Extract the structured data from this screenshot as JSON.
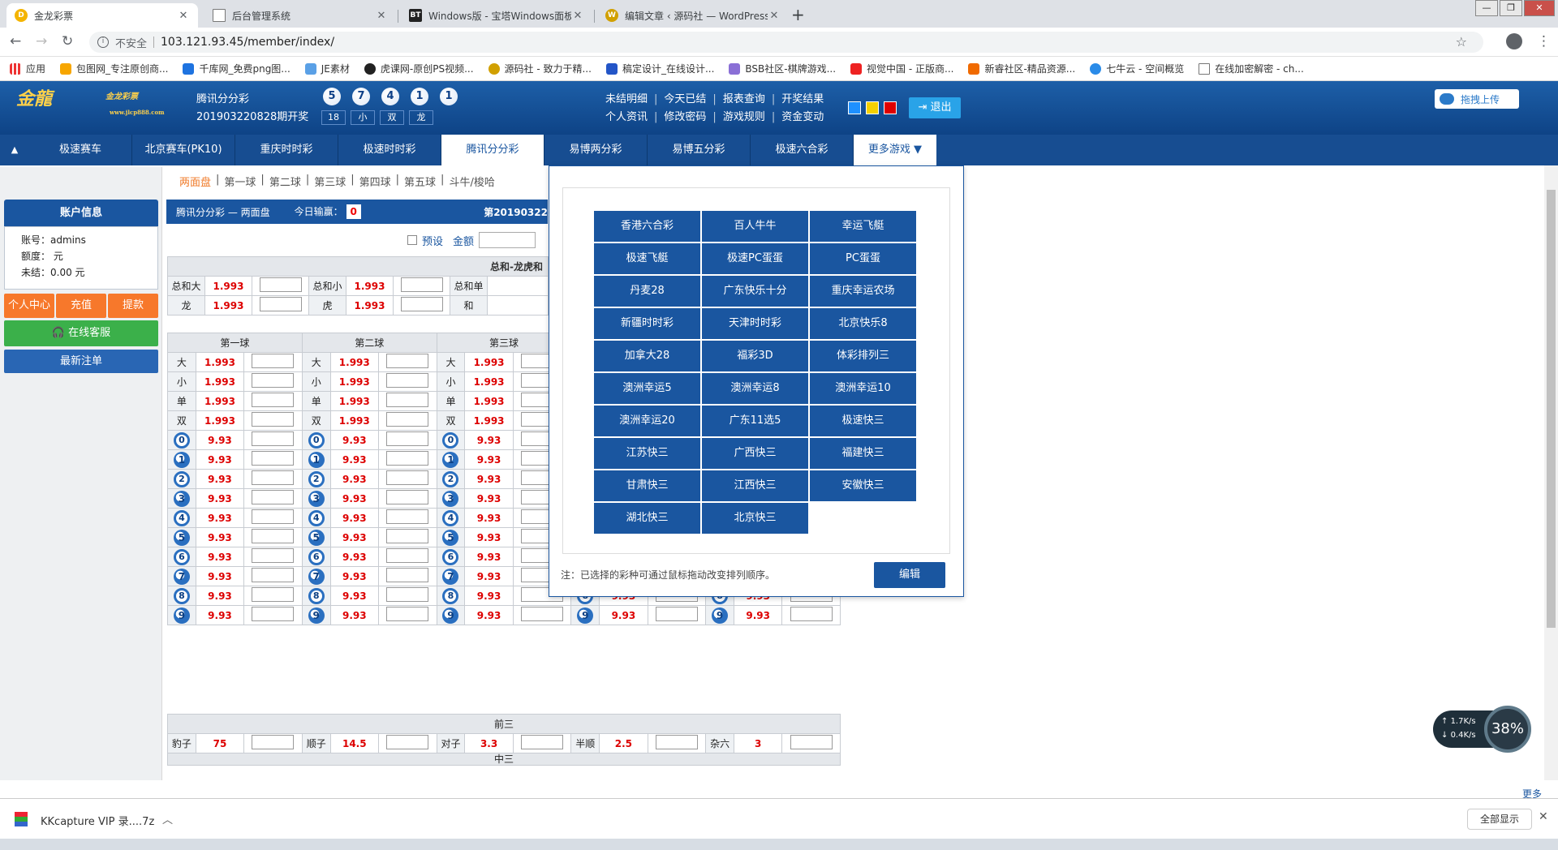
{
  "browser": {
    "tabs": [
      {
        "title": "金龙彩票",
        "color": "#f4b400",
        "glyph": "D"
      },
      {
        "title": "后台管理系统",
        "color": "#9aa0a6",
        "glyph": ""
      },
      {
        "title": "Windows版 - 宝塔Windows面板",
        "color": "#222222",
        "glyph": "BT"
      },
      {
        "title": "编辑文章 ‹ 源码社 — WordPress",
        "color": "#d1a000",
        "glyph": "W"
      }
    ],
    "url_prefix": "不安全",
    "url": "103.121.93.45/member/index/",
    "bookmarks": [
      "应用",
      "包图网_专注原创商...",
      "千库网_免费png图...",
      "JE素材",
      "虎课网-原创PS视频...",
      "源码社 - 致力于精...",
      "稿定设计_在线设计...",
      "BSB社区-棋牌游戏...",
      "视觉中国 - 正版商...",
      "新睿社区-精品资源...",
      "七牛云 - 空间概览",
      "在线加密解密 - ch..."
    ]
  },
  "header": {
    "game_name": "腾讯分分彩",
    "period": "201903220828期开奖",
    "balls": [
      "5",
      "7",
      "4",
      "1",
      "1"
    ],
    "tags": [
      "18",
      "小",
      "双",
      "龙"
    ],
    "links_row1": [
      "未结明细",
      "今天已结",
      "报表查询",
      "开奖结果"
    ],
    "links_row2": [
      "个人资讯",
      "修改密码",
      "游戏规则",
      "资金变动"
    ],
    "skin_colors": [
      "#1e90ff",
      "#f5d000",
      "#e00000"
    ],
    "logout": "退出",
    "upload": "拖拽上传"
  },
  "nav": {
    "items": [
      "极速赛车",
      "北京赛车(PK10)",
      "重庆时时彩",
      "极速时时彩",
      "腾讯分分彩",
      "易博两分彩",
      "易博五分彩",
      "极速六合彩"
    ],
    "active_index": 4,
    "more": "更多游戏 ▼"
  },
  "subtabs": [
    "两面盘",
    "第一球",
    "第二球",
    "第三球",
    "第四球",
    "第五球",
    "斗牛/梭哈"
  ],
  "account": {
    "title": "账户信息",
    "username": "账号：admins",
    "quota": "额度： 元",
    "unsettled": "未结：0.00 元",
    "buttons": [
      "个人中心",
      "充值",
      "提款"
    ],
    "service": "在线客服",
    "latest": "最新注单"
  },
  "main": {
    "title": "腾讯分分彩 — 两面盘",
    "win_label": "今日输赢：",
    "win_value": "0",
    "period": "第20190322",
    "preset": "预设",
    "amount": "金额",
    "section_title": "总和-龙虎和",
    "sum_rows": [
      [
        "总和大",
        "1.993",
        "总和小",
        "1.993",
        "总和单"
      ],
      [
        "龙",
        "1.993",
        "虎",
        "1.993",
        "和"
      ]
    ],
    "ball_headers": [
      "第一球",
      "第二球",
      "第三球"
    ],
    "two_sided": [
      [
        "大",
        "1.993"
      ],
      [
        "小",
        "1.993"
      ],
      [
        "单",
        "1.993"
      ],
      [
        "双",
        "1.993"
      ]
    ],
    "digits": [
      "0",
      "1",
      "2",
      "3",
      "4",
      "5",
      "6",
      "7",
      "8",
      "9"
    ],
    "digit_odds": "9.93",
    "qian_san": "前三",
    "combos": [
      [
        "豹子",
        "75"
      ],
      [
        "顺子",
        "14.5"
      ],
      [
        "对子",
        "3.3"
      ],
      [
        "半顺",
        "2.5"
      ],
      [
        "杂六",
        "3"
      ]
    ],
    "zhong_san": "中三"
  },
  "popup": {
    "games": [
      "香港六合彩",
      "百人牛牛",
      "幸运飞艇",
      "极速飞艇",
      "极速PC蛋蛋",
      "PC蛋蛋",
      "丹麦28",
      "广东快乐十分",
      "重庆幸运农场",
      "新疆时时彩",
      "天津时时彩",
      "北京快乐8",
      "加拿大28",
      "福彩3D",
      "体彩排列三",
      "澳洲幸运5",
      "澳洲幸运8",
      "澳洲幸运10",
      "澳洲幸运20",
      "广东11选5",
      "极速快三",
      "江苏快三",
      "广西快三",
      "福建快三",
      "甘肃快三",
      "江西快三",
      "安徽快三",
      "湖北快三",
      "北京快三"
    ],
    "note": "注：已选择的彩种可通过鼠标拖动改变排列顺序。",
    "edit": "编辑"
  },
  "widget": {
    "up": "1.7K/s",
    "down": "0.4K/s",
    "percent": "38%"
  },
  "bottom": {
    "more": "更多",
    "download": "KKcapture VIP 录....7z",
    "show_all": "全部显示"
  }
}
